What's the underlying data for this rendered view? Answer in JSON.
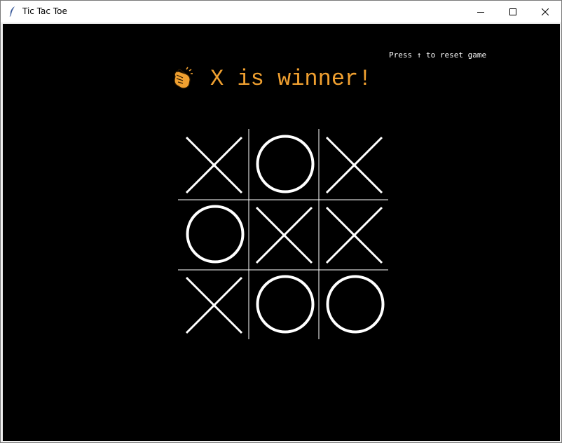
{
  "window": {
    "title": "Tic Tac Toe"
  },
  "hint": {
    "text": "Press ↑ to reset game"
  },
  "status": {
    "message": "X is winner!",
    "icon": "clapping-hands-icon",
    "color": "#f0a030"
  },
  "board": {
    "cells": [
      "X",
      "O",
      "X",
      "O",
      "X",
      "X",
      "X",
      "O",
      "O"
    ],
    "line_color": "#ffffff",
    "background": "#000000"
  }
}
